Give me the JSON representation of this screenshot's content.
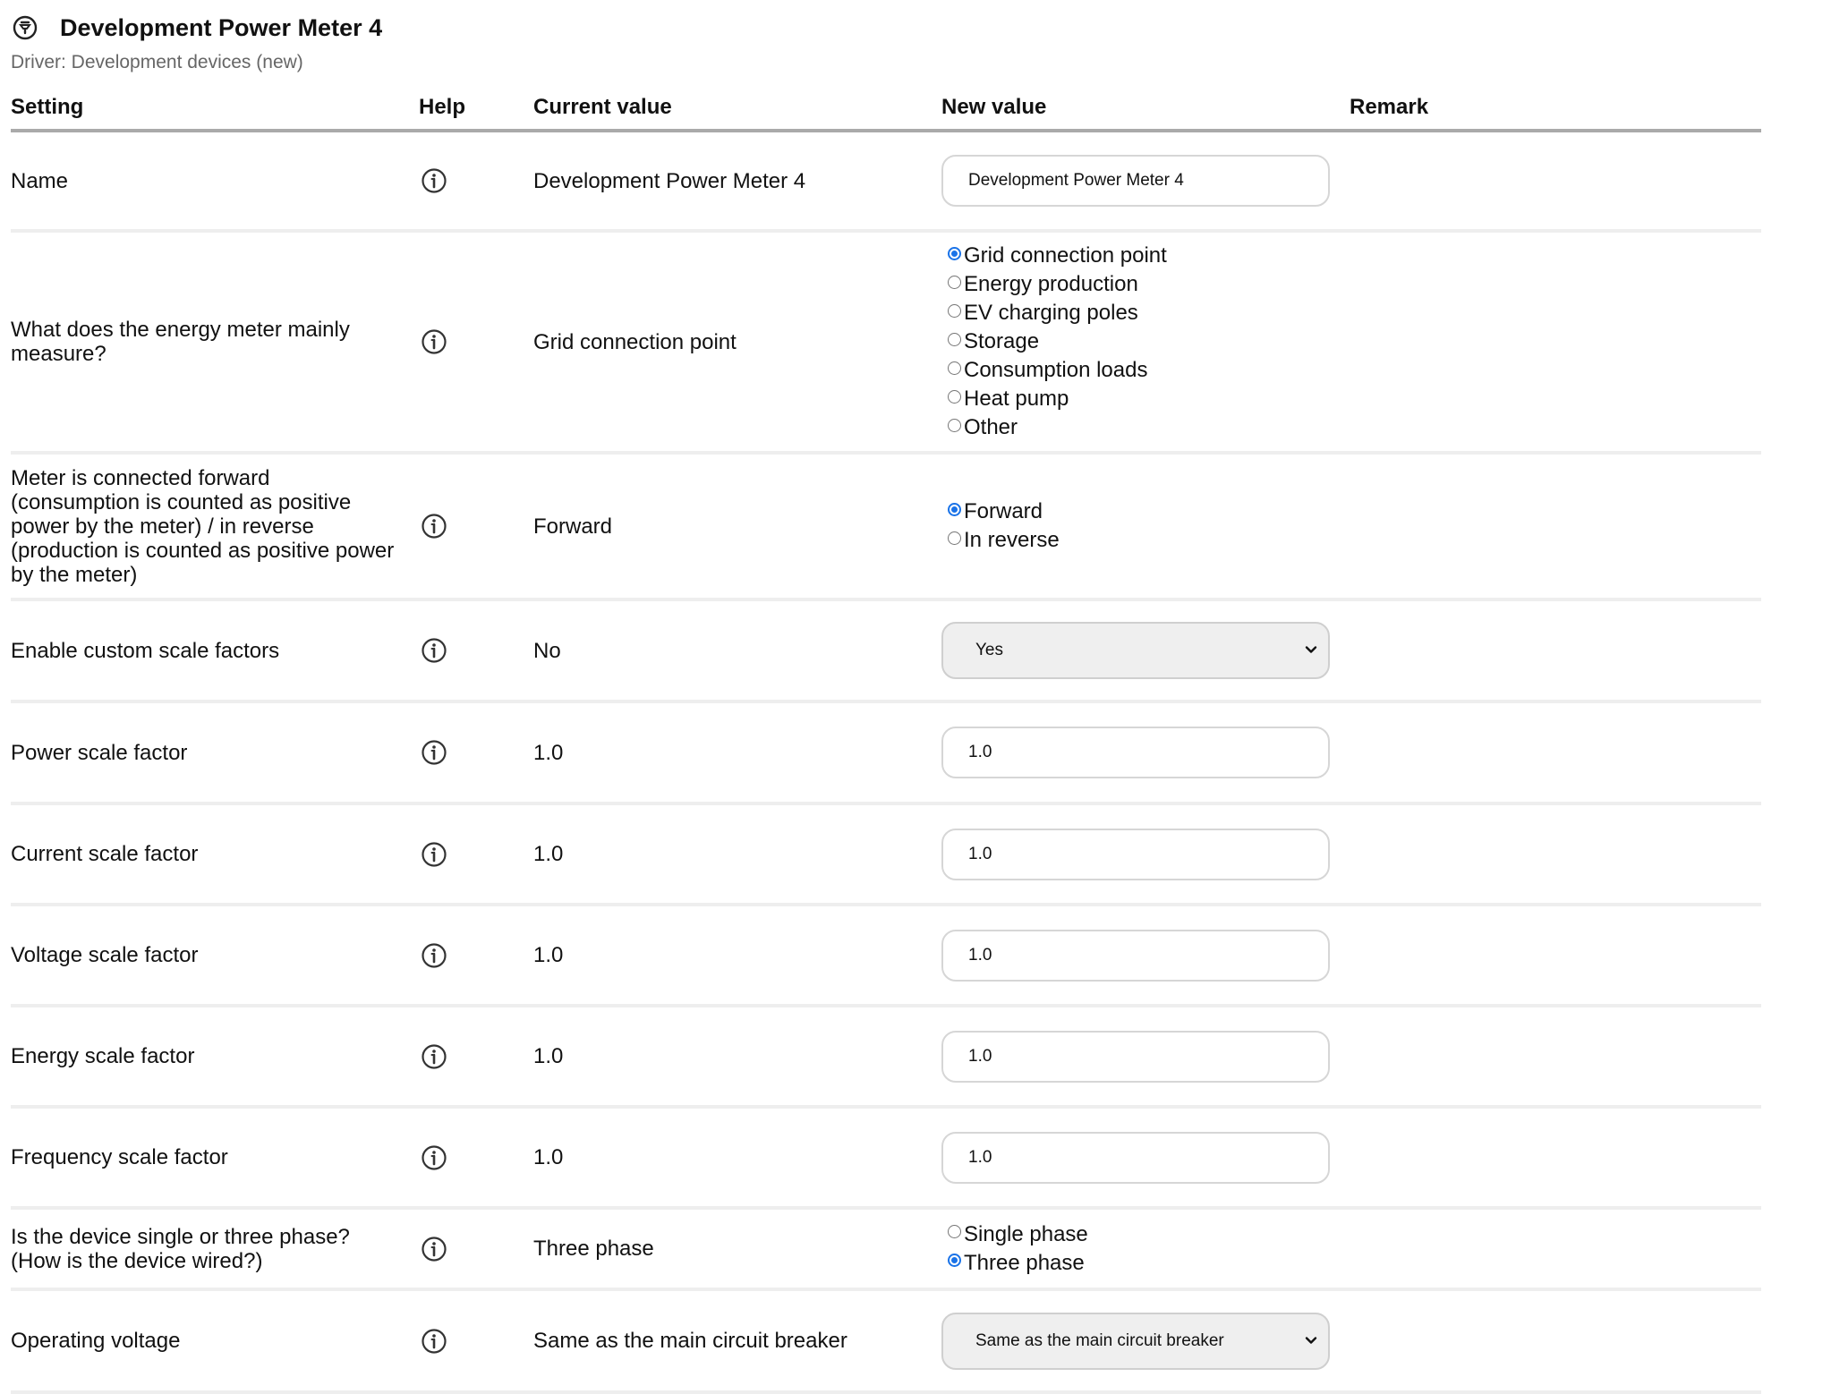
{
  "page": {
    "title": "Development Power Meter 4",
    "driver": "Driver: Development devices (new)",
    "logo_icon": "power-plug-icon"
  },
  "columns": {
    "setting": "Setting",
    "help": "Help",
    "current": "Current value",
    "new": "New value",
    "remark": "Remark"
  },
  "help_icon": "info-circle-icon",
  "accent_color": "#1a73e8",
  "rows": {
    "name": {
      "label": "Name",
      "current": "Development Power Meter 4",
      "value": "Development Power Meter 4"
    },
    "measure": {
      "label": "What does the energy meter mainly measure?",
      "current": "Grid connection point",
      "options": [
        "Grid connection point",
        "Energy production",
        "EV charging poles",
        "Storage",
        "Consumption loads",
        "Heat pump",
        "Other"
      ],
      "selected": "Grid connection point"
    },
    "direction": {
      "label": "Meter is connected forward (consumption is counted as positive power by the meter) / in reverse (production is counted as positive power by the meter)",
      "current": "Forward",
      "options": [
        "Forward",
        "In reverse"
      ],
      "selected": "Forward"
    },
    "custom_scale": {
      "label": "Enable custom scale factors",
      "current": "No",
      "value": "Yes"
    },
    "power_scale": {
      "label": "Power scale factor",
      "current": "1.0",
      "value": "1.0"
    },
    "current_scale": {
      "label": "Current scale factor",
      "current": "1.0",
      "value": "1.0"
    },
    "voltage_scale": {
      "label": "Voltage scale factor",
      "current": "1.0",
      "value": "1.0"
    },
    "energy_scale": {
      "label": "Energy scale factor",
      "current": "1.0",
      "value": "1.0"
    },
    "frequency_scale": {
      "label": "Frequency scale factor",
      "current": "1.0",
      "value": "1.0"
    },
    "phase": {
      "label": "Is the device single or three phase? (How is the device wired?)",
      "current": "Three phase",
      "options": [
        "Single phase",
        "Three phase"
      ],
      "selected": "Three phase"
    },
    "operating_voltage": {
      "label": "Operating voltage",
      "current": "Same as the main circuit breaker",
      "value": "Same as the main circuit breaker"
    }
  }
}
